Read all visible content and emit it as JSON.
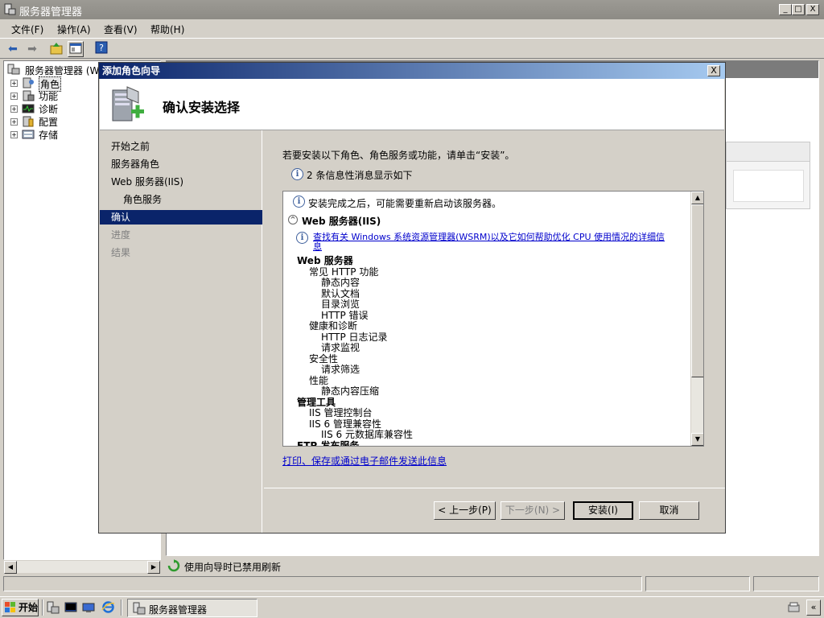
{
  "window": {
    "title": "服务器管理器",
    "controls": {
      "minimize": "_",
      "maximize": "□",
      "close": "X"
    }
  },
  "menu": [
    "文件(F)",
    "操作(A)",
    "查看(V)",
    "帮助(H)"
  ],
  "tree": {
    "root": "服务器管理器 (W",
    "items": [
      "角色",
      "功能",
      "诊断",
      "配置",
      "存储"
    ]
  },
  "status": {
    "refresh_text": "使用向导时已禁用刷新"
  },
  "taskbar": {
    "start_label": "开始",
    "active_task": "服务器管理器"
  },
  "dialog": {
    "title": "添加角色向导",
    "close": "X",
    "heading": "确认安装选择",
    "nav": [
      {
        "label": "开始之前",
        "state": "normal"
      },
      {
        "label": "服务器角色",
        "state": "normal"
      },
      {
        "label": "Web 服务器(IIS)",
        "state": "normal"
      },
      {
        "label": "角色服务",
        "state": "sub"
      },
      {
        "label": "确认",
        "state": "active"
      },
      {
        "label": "进度",
        "state": "disabled"
      },
      {
        "label": "结果",
        "state": "disabled"
      }
    ],
    "instruction": "若要安装以下角色、角色服务或功能，请单击“安装”。",
    "info_count": "2 条信息性消息显示如下",
    "results": {
      "restart_notice": "安装完成之后，可能需要重新启动该服务器。",
      "section_title": "Web 服务器(IIS)",
      "wsrm_link_line1": "查找有关 Windows 系统资源管理器(WSRM)以及它如何帮助优化 CPU 使用情况的详细信",
      "wsrm_link_line2": "息",
      "tree": [
        {
          "text": "Web 服务器",
          "level": 0,
          "bold": true
        },
        {
          "text": "常见 HTTP 功能",
          "level": 1
        },
        {
          "text": "静态内容",
          "level": 2
        },
        {
          "text": "默认文档",
          "level": 2
        },
        {
          "text": "目录浏览",
          "level": 2
        },
        {
          "text": "HTTP 错误",
          "level": 2
        },
        {
          "text": "健康和诊断",
          "level": 1
        },
        {
          "text": "HTTP 日志记录",
          "level": 2
        },
        {
          "text": "请求监视",
          "level": 2
        },
        {
          "text": "安全性",
          "level": 1
        },
        {
          "text": "请求筛选",
          "level": 2
        },
        {
          "text": "性能",
          "level": 1
        },
        {
          "text": "静态内容压缩",
          "level": 2
        },
        {
          "text": "管理工具",
          "level": 0,
          "bold": true
        },
        {
          "text": "IIS 管理控制台",
          "level": 1
        },
        {
          "text": "IIS 6 管理兼容性",
          "level": 1
        },
        {
          "text": "IIS 6 元数据库兼容性",
          "level": 2
        },
        {
          "text": "FTP 发布服务",
          "level": 0,
          "bold": true
        }
      ]
    },
    "print_link": "打印、保存或通过电子邮件发送此信息",
    "buttons": {
      "back": "< 上一步(P)",
      "next": "下一步(N) >",
      "install": "安装(I)",
      "cancel": "取消"
    }
  }
}
